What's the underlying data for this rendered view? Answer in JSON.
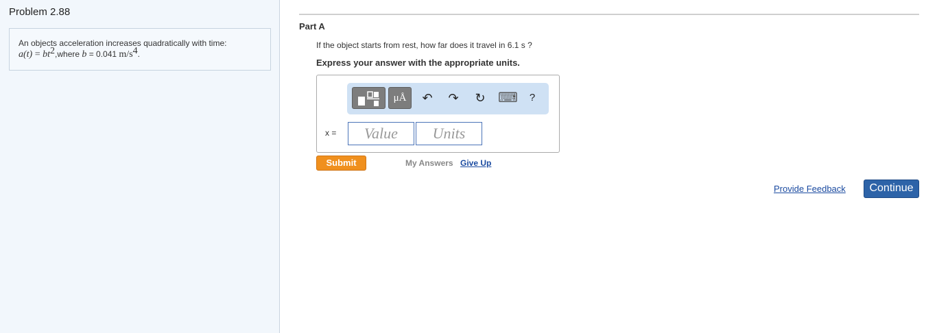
{
  "sidebar": {
    "problem_title": "Problem 2.88",
    "statement_text": "An objects acceleration increases quadratically with time:",
    "formula_lhs": "a(t)",
    "formula_eq": " = ",
    "formula_rhs_base": "bt",
    "formula_rhs_exp": "2",
    "formula_where": ",where ",
    "formula_b": "b",
    "formula_b_value": " = 0.041 ",
    "formula_units_base": "m/s",
    "formula_units_exp": "4",
    "formula_end": "."
  },
  "part": {
    "label": "Part A",
    "question": "If the object starts from rest, how far does it travel in 6.1  s ?",
    "instruction": "Express your answer with the appropriate units."
  },
  "answer": {
    "variable_label": "x =",
    "value_placeholder": "Value",
    "units_placeholder": "Units"
  },
  "toolbar": {
    "units_label": "μÅ",
    "undo_icon": "↶",
    "redo_icon": "↷",
    "reset_icon": "↻",
    "keyboard_icon": "⌨",
    "help_label": "?"
  },
  "actions": {
    "submit_label": "Submit",
    "my_answers_label": "My Answers",
    "give_up_label": "Give Up",
    "feedback_label": "Provide Feedback",
    "continue_label": "Continue"
  },
  "colors": {
    "submit": "#f0901e",
    "continue": "#2d63a8",
    "link": "#1a4aa0",
    "toolbar_bg": "#cfe1f4"
  }
}
